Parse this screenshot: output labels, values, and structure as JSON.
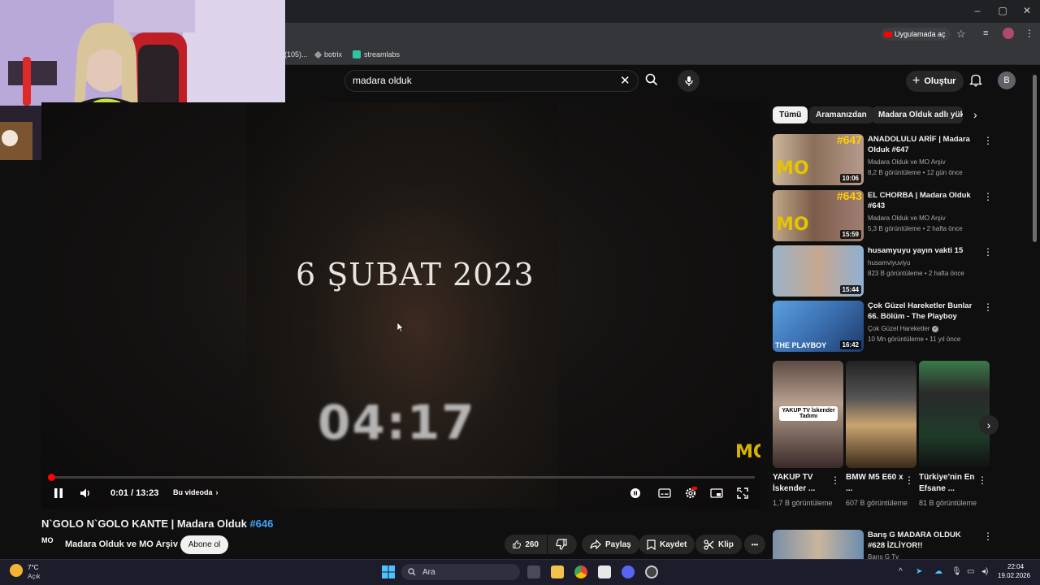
{
  "browser": {
    "window_controls": [
      "–",
      "▢",
      "✕"
    ],
    "bookmarks": [
      {
        "label": "(105)..."
      },
      {
        "label": "botrix"
      },
      {
        "label": "streamlabs"
      }
    ],
    "open_in_app_label": "Uygulamada aç"
  },
  "youtube": {
    "search_value": "madara olduk",
    "create_label": "Oluştur",
    "avatar_letter": "B"
  },
  "player": {
    "overlay_date": "6 ŞUBAT 2023",
    "overlay_time": "04:17",
    "time_display": "0:01 / 13:23",
    "progress_fraction": 0.0013,
    "chapters_label": "Bu videoda",
    "watermark": "MO"
  },
  "video": {
    "title": "N`GOLO N`GOLO KANTE | Madara Olduk",
    "hashtag": "#646",
    "channel_name": "Madara Olduk ve MO Arşiv",
    "channel_logo": "MO",
    "subscribe_label": "Abone ol",
    "likes": "260",
    "share_label": "Paylaş",
    "save_label": "Kaydet",
    "clip_label": "Klip",
    "more_label": "•••"
  },
  "sidebar": {
    "chips": [
      "Tümü",
      "Aramanızdan",
      "Madara Olduk adlı yükleyiciden"
    ],
    "recommendations": [
      {
        "title": "ANADOLULU ARİF | Madara Olduk #647",
        "channel": "Madara Olduk ve MO Arşiv",
        "meta": "8,2 B görüntüleme • 12 gün önce",
        "duration": "10:06",
        "badge": "#647",
        "verified": false
      },
      {
        "title": "EL CHORBA | Madara Olduk #643",
        "channel": "Madara Olduk ve MO Arşiv",
        "meta": "5,3 B görüntüleme • 2 hafta önce",
        "duration": "15:59",
        "badge": "#643",
        "verified": false
      },
      {
        "title": "husamyuyu yayın vakti 15",
        "channel": "husamviyuviyu",
        "meta": "823 B görüntüleme • 2 hafta önce",
        "duration": "15:44",
        "badge": "",
        "verified": false
      },
      {
        "title": "Çok Güzel Hareketler Bunlar 66. Bölüm - The Playboy",
        "channel": "Çok Güzel Hareketler",
        "meta": "10 Mn görüntüleme • 11 yıl önce",
        "duration": "16:42",
        "badge": "THE PLAYBOY",
        "verified": true
      }
    ],
    "shorts": [
      {
        "title": "YAKUP TV İskender ...",
        "views": "1,7 B görüntüleme",
        "caption": "YAKUP TV İskender Tadımı"
      },
      {
        "title": "BMW M5 E60 x ...",
        "views": "607 B görüntüleme",
        "caption": ""
      },
      {
        "title": "Türkiye'nin En Efsane ...",
        "views": "81 B görüntüleme",
        "caption": ""
      }
    ],
    "last_rec": {
      "title": "Barış G MADARA OLDUK #628 İZLİYOR!!",
      "channel": "Barış G Tv"
    }
  },
  "taskbar": {
    "weather_temp": "7°C",
    "weather_desc": "Açık",
    "search_label": "Ara",
    "time": "22:04",
    "date": "19.02.2026"
  },
  "colors": {
    "accent_red": "#ff0000",
    "link_blue": "#3ea6ff",
    "bg": "#0f0f0f"
  }
}
